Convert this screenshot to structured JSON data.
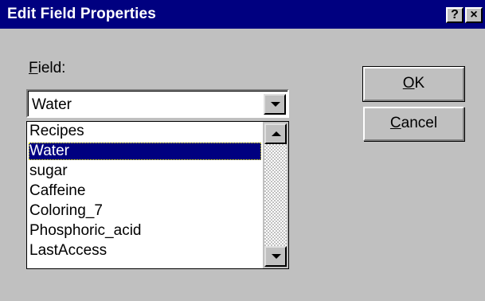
{
  "window": {
    "title": "Edit Field Properties",
    "help_glyph": "?",
    "close_glyph": "×"
  },
  "field": {
    "label_mnemonic": "F",
    "label_rest": "ield:",
    "value": "Water",
    "items": [
      {
        "label": "Recipes",
        "selected": false
      },
      {
        "label": "Water",
        "selected": true
      },
      {
        "label": "sugar",
        "selected": false
      },
      {
        "label": "Caffeine",
        "selected": false
      },
      {
        "label": "Coloring_7",
        "selected": false
      },
      {
        "label": "Phosphoric_acid",
        "selected": false
      },
      {
        "label": "LastAccess",
        "selected": false
      }
    ]
  },
  "buttons": {
    "ok_mnemonic": "O",
    "ok_rest": "K",
    "cancel_mnemonic": "C",
    "cancel_rest": "ancel"
  },
  "colors": {
    "titlebar": "#000080",
    "face": "#c0c0c0",
    "selection": "#000080"
  }
}
